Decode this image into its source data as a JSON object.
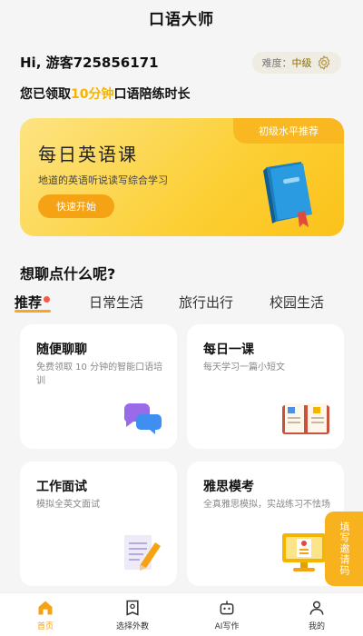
{
  "header": {
    "title": "口语大师"
  },
  "user": {
    "greeting": "Hi, 游客725856171",
    "level_prefix": "难度：",
    "level_value": "中级"
  },
  "claim": {
    "before": "您已领取",
    "highlight": "10分钟",
    "after": "口语陪练时长"
  },
  "banner": {
    "tag": "初级水平推荐",
    "title": "每日英语课",
    "subtitle": "地道的英语听说读写综合学习",
    "button": "快速开始"
  },
  "section": {
    "title": "想聊点什么呢?"
  },
  "tabs": [
    {
      "label": "推荐"
    },
    {
      "label": "日常生活"
    },
    {
      "label": "旅行出行"
    },
    {
      "label": "校园生活"
    }
  ],
  "cards": [
    {
      "title": "随便聊聊",
      "desc": "免费领取 10 分钟的智能口语培训",
      "icon": "chat-bubbles-icon"
    },
    {
      "title": "每日一课",
      "desc": "每天学习一篇小短文",
      "icon": "open-book-icon"
    },
    {
      "title": "工作面试",
      "desc": "模拟全英文面试",
      "icon": "document-pencil-icon"
    },
    {
      "title": "雅思模考",
      "desc": "全真雅思模拟，实战练习不怯场",
      "icon": "computer-exam-icon"
    }
  ],
  "invite": {
    "label": "填写邀请码"
  },
  "nav": [
    {
      "label": "首页",
      "icon": "home-icon"
    },
    {
      "label": "选择外教",
      "icon": "teacher-icon"
    },
    {
      "label": "AI写作",
      "icon": "robot-icon"
    },
    {
      "label": "我的",
      "icon": "profile-icon"
    }
  ],
  "colors": {
    "accent": "#f5a214",
    "highlight": "#f5b400",
    "dot": "#f15b4b"
  }
}
